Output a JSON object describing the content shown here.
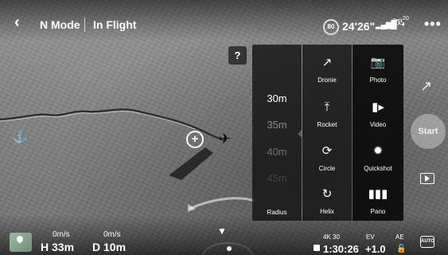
{
  "top_bar": {
    "back_icon": "chevron-left-icon",
    "mode": "N Mode",
    "status": "In Flight",
    "battery_percent": "80",
    "flight_time": "24'26\"",
    "signal_icon": "signal-bars-icon",
    "gps_icon": "satellite-icon",
    "gps_count": "20",
    "more_icon": "more-icon"
  },
  "help": {
    "label": "?"
  },
  "quickshot_menu": {
    "radius": {
      "title": "Radius",
      "values": [
        "30m",
        "35m",
        "40m",
        "45m"
      ]
    },
    "modes": [
      {
        "label": "Dronie",
        "icon": "dronie-icon"
      },
      {
        "label": "Rocket",
        "icon": "rocket-icon"
      },
      {
        "label": "Circle",
        "icon": "circle-icon"
      },
      {
        "label": "Helix",
        "icon": "helix-icon"
      }
    ],
    "camera_modes": [
      {
        "label": "Photo",
        "icon": "camera-icon"
      },
      {
        "label": "Video",
        "icon": "video-icon"
      },
      {
        "label": "Quickshot",
        "icon": "quickshot-icon"
      },
      {
        "label": "Pano",
        "icon": "pano-icon"
      }
    ]
  },
  "right_rail": {
    "start_label": "Start",
    "dronie_icon": "dronie-icon",
    "playback_icon": "playback-icon"
  },
  "bottom_bar": {
    "horizontal_speed": "0m/s",
    "vertical_speed": "0m/s",
    "height": "H 33m",
    "distance": "D 10m",
    "resolution": "4K 30",
    "record_time": "1:30:26",
    "ev_label": "EV",
    "ev_value": "+1.0",
    "ae_label": "AE",
    "auto_label": "AUTO"
  }
}
